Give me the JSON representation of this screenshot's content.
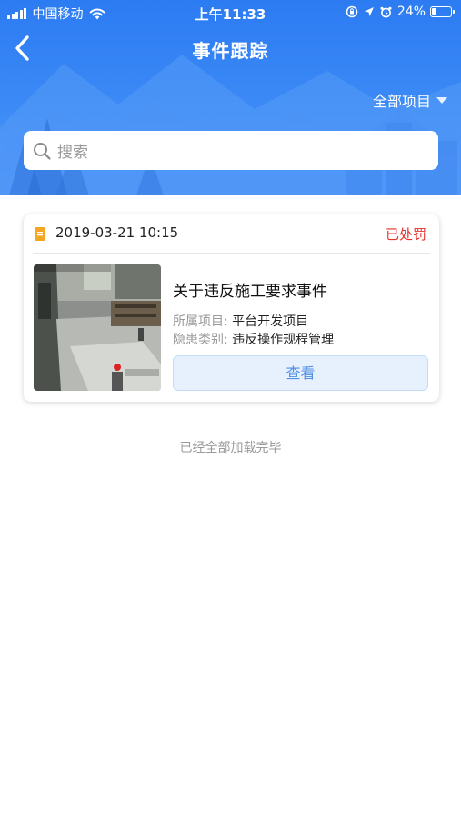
{
  "status_bar": {
    "carrier": "中国移动",
    "time": "上午11:33",
    "battery_percent": "24%",
    "battery_level": 0.24,
    "icons": [
      "signal-icon",
      "wifi-icon",
      "rotation-lock-icon",
      "location-icon",
      "alarm-icon",
      "battery-icon"
    ]
  },
  "nav": {
    "title": "事件跟踪",
    "back_icon": "chevron-left-icon",
    "project_filter": "全部项目"
  },
  "search": {
    "placeholder": "搜索",
    "icon": "search-icon"
  },
  "events": [
    {
      "datetime": "2019-03-21 10:15",
      "status": "已处罚",
      "title": "关于违反施工要求事件",
      "project_label": "所属项目:",
      "project_value": "平台开发项目",
      "hazard_label": "隐患类别:",
      "hazard_value": "违反操作规程管理",
      "view_button": "查看"
    }
  ],
  "footer_note": "已经全部加载完毕",
  "colors": {
    "header_blue": "#3486f4",
    "status_red": "#e5312c",
    "button_text_blue": "#4f8fe6",
    "doc_icon_orange": "#f5a623"
  }
}
